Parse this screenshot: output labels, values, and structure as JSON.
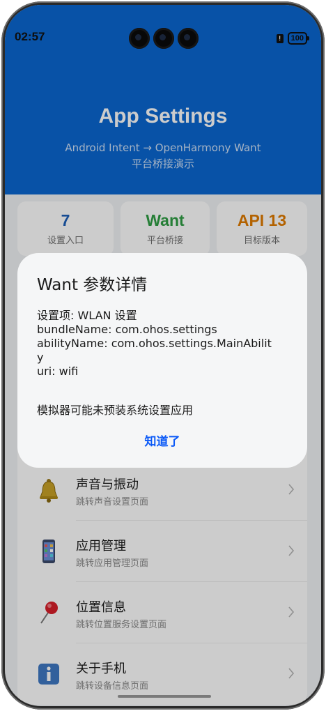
{
  "status_bar": {
    "time": "02:57",
    "sim_label": "!",
    "battery_level": "100"
  },
  "header": {
    "title": "App Settings",
    "subtitle_line1": "Android Intent → OpenHarmony Want",
    "subtitle_line2": "平台桥接演示",
    "background_color": "#0a67d1"
  },
  "stats": [
    {
      "value": "7",
      "label": "设置入口",
      "color": "#1d5fb8"
    },
    {
      "value": "Want",
      "label": "平台桥接",
      "color": "#2f9e44"
    },
    {
      "value": "API 13",
      "label": "目标版本",
      "color": "#e07b00"
    }
  ],
  "settings_list": [
    {
      "title": "声音与振动",
      "subtitle": "跳转声音设置页面",
      "icon": "bell-icon"
    },
    {
      "title": "应用管理",
      "subtitle": "跳转应用管理页面",
      "icon": "phone-device-icon"
    },
    {
      "title": "位置信息",
      "subtitle": "跳转位置服务设置页面",
      "icon": "pushpin-icon"
    },
    {
      "title": "关于手机",
      "subtitle": "跳转设备信息页面",
      "icon": "info-icon"
    }
  ],
  "dialog": {
    "title": "Want 参数详情",
    "lines": [
      "设置项: WLAN 设置",
      "bundleName: com.ohos.settings",
      "abilityName: com.ohos.settings.MainAbilit",
      "y",
      "uri: wifi"
    ],
    "note": "模拟器可能未预装系统设置应用",
    "confirm_label": "知道了"
  }
}
